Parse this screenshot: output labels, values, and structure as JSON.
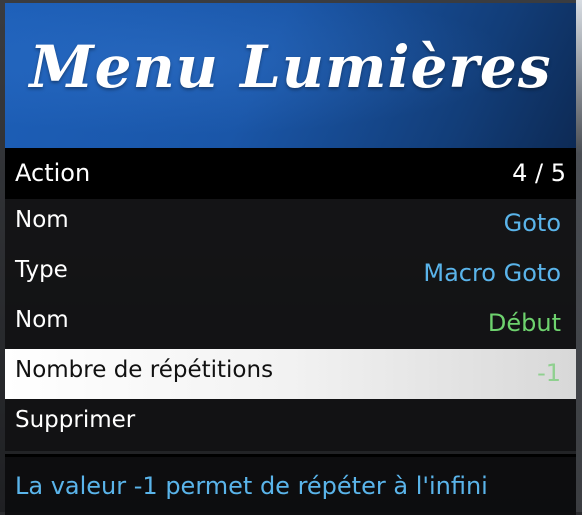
{
  "menu": {
    "title": "Menu Lumières",
    "subtitle": "Action",
    "counter": "4 / 5",
    "items": [
      {
        "label": "Nom",
        "value": "Goto"
      },
      {
        "label": "Type",
        "value": "Macro Goto"
      },
      {
        "label": "Nom",
        "value": "Début"
      },
      {
        "label": "Nombre de répétitions",
        "value": "-1"
      },
      {
        "label": "Supprimer",
        "value": ""
      }
    ],
    "description": "La valeur -1 permet de répéter à l'infini"
  },
  "colors": {
    "banner": "#1a56a8",
    "value_blue": "#5ab4ea",
    "value_green": "#6ed26e",
    "selected_value": "#8fd08f",
    "description_text": "#5ab4ea"
  }
}
